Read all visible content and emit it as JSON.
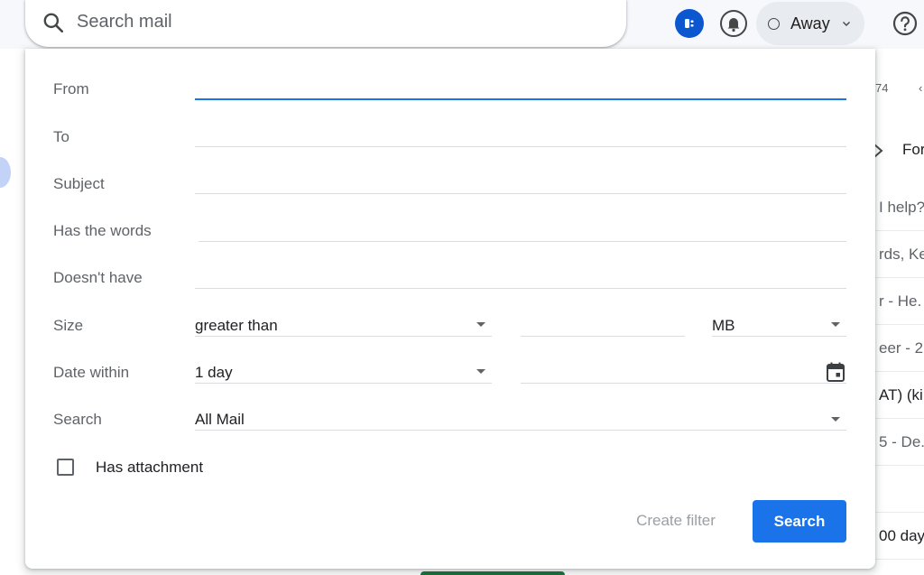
{
  "topbar": {
    "search_placeholder": "Search mail",
    "status_label": "Away"
  },
  "background": {
    "count_text": "74",
    "tab_label": "For",
    "rows": [
      "I help?",
      "rds, Ke",
      "r - He.",
      "eer - 2",
      "AT) (ki.",
      "5 - De.",
      "",
      "00 day"
    ]
  },
  "dialog": {
    "from_label": "From",
    "to_label": "To",
    "subject_label": "Subject",
    "has_words_label": "Has the words",
    "doesnt_have_label": "Doesn't have",
    "size_label": "Size",
    "size_operator": "greater than",
    "size_unit": "MB",
    "date_within_label": "Date within",
    "date_within_value": "1 day",
    "search_label": "Search",
    "search_scope": "All Mail",
    "has_attachment_label": "Has attachment",
    "has_attachment_checked": false,
    "create_filter_label": "Create filter",
    "search_button_label": "Search"
  },
  "colors": {
    "accent": "#1a73e8",
    "status_icon": "#0b57d0",
    "topbar_bg": "#f6f8fc"
  },
  "icons": [
    "search-icon",
    "status-app-icon",
    "notification-bell-icon",
    "status-circle-icon",
    "chevron-down-icon",
    "help-icon",
    "calendar-icon",
    "forward-icon"
  ]
}
